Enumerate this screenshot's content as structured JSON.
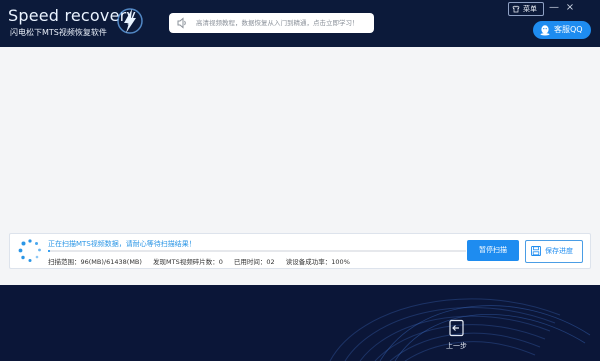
{
  "header": {
    "logo_title": "Speed recovery",
    "logo_subtitle": "闪电松下MTS视频恢复软件",
    "notice_text": "高清视频教程，数据恢复从入门到精通，点击立即学习！",
    "menu_label": "菜单",
    "min_glyph": "—",
    "close_glyph": "×",
    "qq_label": "客服QQ"
  },
  "scan": {
    "status_text": "正在扫描MTS视频数据，请耐心等待扫描结果！",
    "progress": 0.0016,
    "scan_range": "扫描范围：96(MB)/61438(MB)",
    "found_count": "发现MTS视频碎片数：0",
    "elapsed": "已用时间：02",
    "read_success": "读设备成功率：100%",
    "pause_label": "暂停扫描",
    "save_label": "保存进度"
  },
  "footer": {
    "prev_label": "上一步"
  },
  "colors": {
    "header_bg": "#0c1a3a",
    "accent": "#1e8cf0",
    "status_text": "#2b96e6"
  },
  "icons": {
    "logo": "lightning-bolt-icon",
    "notice": "speaker-icon",
    "menu": "shirt-icon",
    "qq": "qq-penguin-icon",
    "spinner": "loading-spinner-icon",
    "save": "floppy-disk-icon",
    "prev": "exit-door-icon"
  }
}
